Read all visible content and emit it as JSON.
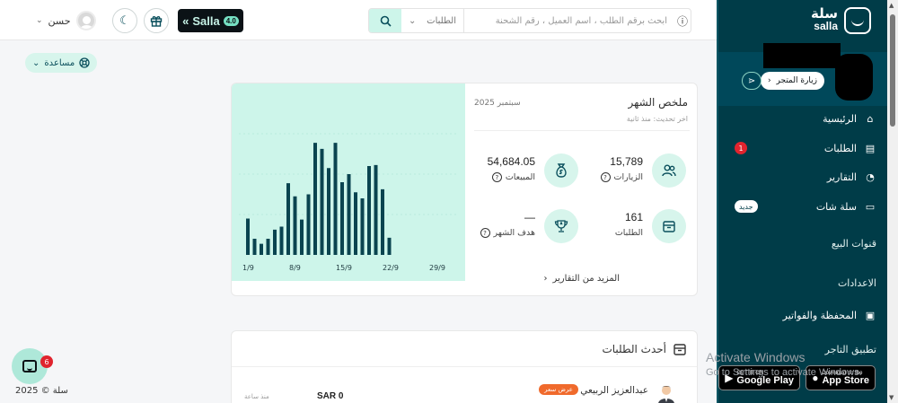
{
  "header": {
    "user_name": "حسن",
    "salla_badge": "Salla",
    "salla_version": "4.0",
    "search_placeholder": "ابحث برقم الطلب ، اسم العميل ، رقم الشحنة",
    "search_scope": "الطلبات"
  },
  "help": {
    "label": "مساعدة"
  },
  "summary": {
    "title": "ملخص الشهر",
    "updated": "اخر تحديث: منذ ثانية",
    "month": "سبتمبر 2025",
    "stats": {
      "visits": {
        "value": "15,789",
        "label": "الزيارات",
        "icon": "users-icon"
      },
      "sales": {
        "value": "54,684.05",
        "label": "المبيعات",
        "icon": "money-bag-icon"
      },
      "orders": {
        "value": "161",
        "label": "الطلبات",
        "icon": "box-icon"
      },
      "goal": {
        "value": "—",
        "label": "هدف الشهر",
        "icon": "trophy-icon"
      }
    },
    "more_link": "المزيد من التقارير"
  },
  "chart_data": {
    "type": "bar",
    "x_tick_labels": [
      "1/9",
      "8/9",
      "15/9",
      "22/9",
      "29/9"
    ],
    "categories": [
      "1/9",
      "2/9",
      "3/9",
      "4/9",
      "5/9",
      "6/9",
      "7/9",
      "8/9",
      "9/9",
      "10/9",
      "11/9",
      "12/9",
      "13/9",
      "14/9",
      "15/9",
      "16/9",
      "17/9",
      "18/9",
      "19/9",
      "20/9",
      "21/9",
      "22/9",
      "23/9"
    ],
    "values": [
      36,
      16,
      11,
      16,
      25,
      28,
      71,
      58,
      35,
      60,
      111,
      105,
      86,
      111,
      72,
      80,
      62,
      56,
      88,
      89,
      65,
      17,
      0
    ],
    "ylim": [
      0,
      120
    ],
    "bar_color": "#0a4450",
    "background": "#cdf5ea",
    "grid": false
  },
  "orders": {
    "title": "أحدث الطلبات",
    "rows": [
      {
        "customer": "عبدالعزيز الربيعي",
        "badge": "عرض سعر",
        "price": "SAR 0",
        "time": "منذ ساعة"
      }
    ]
  },
  "chat": {
    "badge_count": "6"
  },
  "footer": {
    "copyright": "سلة © 2025"
  },
  "sidebar": {
    "brand_ar": "سلة",
    "brand_en": "salla",
    "visit_store": "زيارة المتجر",
    "nav": [
      {
        "label": "الرئيسية",
        "icon": "home-icon"
      },
      {
        "label": "الطلبات",
        "icon": "orders-icon",
        "badge": "1"
      },
      {
        "label": "التقارير",
        "icon": "reports-icon"
      },
      {
        "label": "سلة شات",
        "icon": "chat-icon",
        "badge": "جديد"
      }
    ],
    "sections": {
      "sales_channels": "قنوات البيع",
      "settings": "الاعدادات",
      "wallet": "المحفظة والفواتير",
      "merchant_app": "تطبيق التاجر"
    },
    "google_play_small": "GET IT ON",
    "google_play": "Google Play",
    "app_store_small": "Download on the",
    "app_store": "App Store"
  },
  "watermark": {
    "line1": "Activate Windows",
    "line2": "Go to Settings to activate Windows."
  },
  "colors": {
    "brand_dark": "#003c48",
    "mint": "#cdf5ea",
    "badge_red": "#e0242e",
    "offer_orange": "#f06a2c"
  }
}
